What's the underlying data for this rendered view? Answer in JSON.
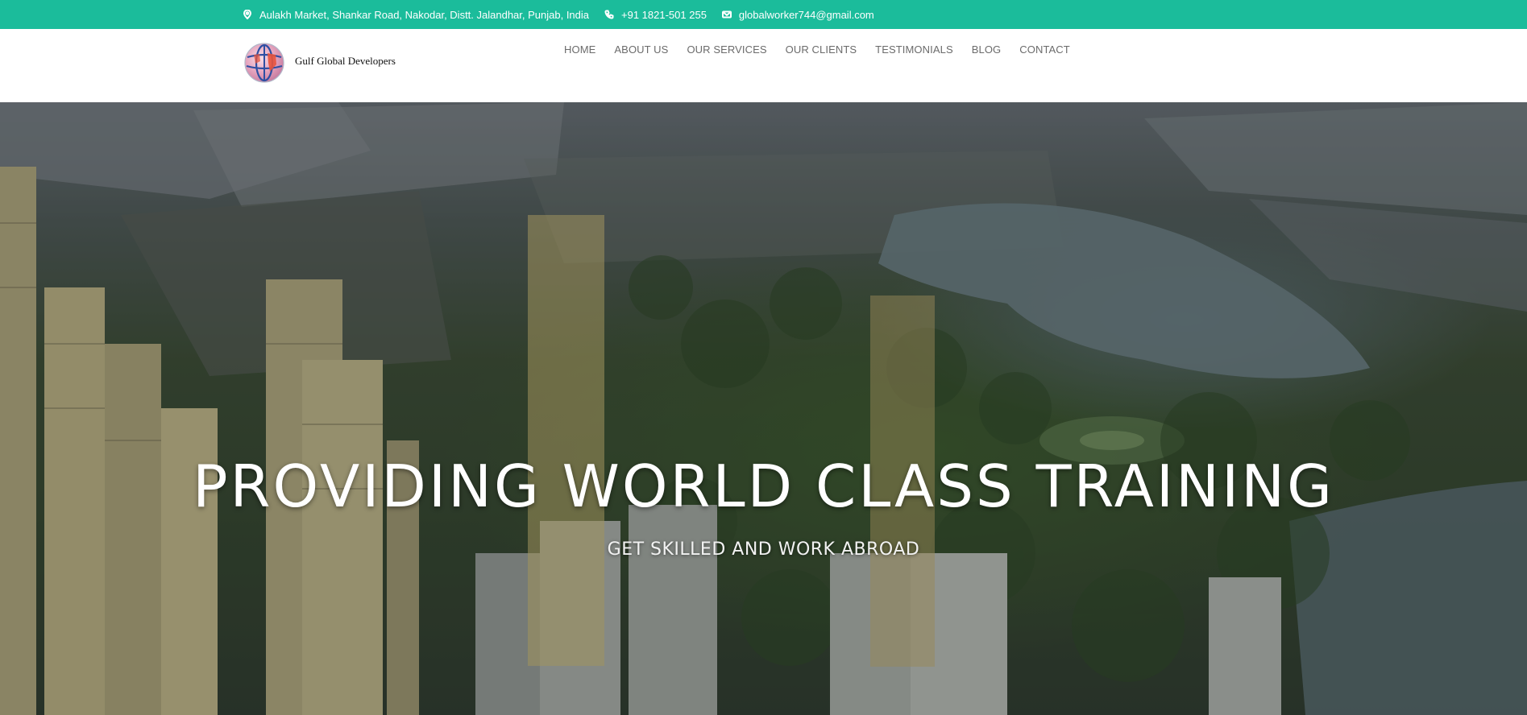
{
  "topbar": {
    "address": "Aulakh Market, Shankar Road, Nakodar, Distt. Jalandhar, Punjab, India",
    "phone": "+91 1821-501 255",
    "email": "globalworker744@gmail.com",
    "address_icon": "map-marker-icon",
    "phone_icon": "phone-icon",
    "email_icon": "envelope-icon",
    "bg_color": "#1bbc9b"
  },
  "header": {
    "brand": "Gulf Global Developers",
    "nav": [
      "HOME",
      "ABOUT US",
      "OUR SERVICES",
      "OUR CLIENTS",
      "TESTIMONIALS",
      "BLOG",
      "CONTACT"
    ]
  },
  "hero": {
    "title": "PROVIDING WORLD CLASS TRAINING",
    "subtitle": "GET SKILLED AND WORK ABROAD"
  }
}
